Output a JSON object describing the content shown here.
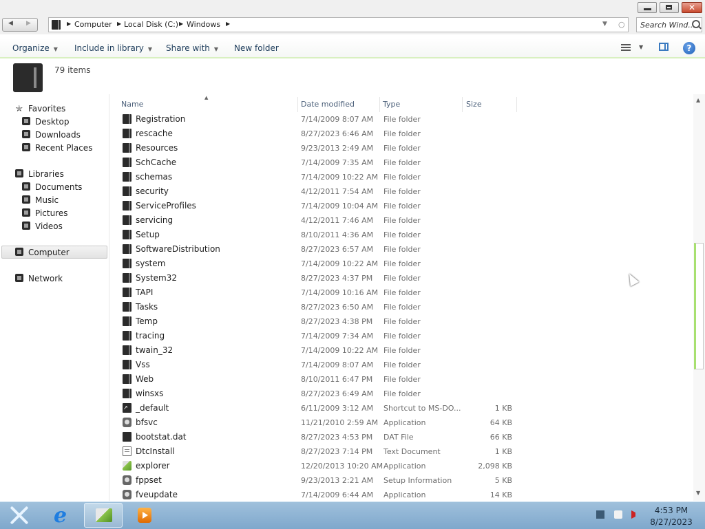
{
  "window": {
    "minimize_label": "",
    "maximize_label": "",
    "close_label": "✕"
  },
  "address": {
    "crumbs": [
      "Computer",
      "Local Disk (C:)",
      "Windows"
    ],
    "search_placeholder": "Search Wind..."
  },
  "toolbar": {
    "organize": "Organize",
    "include_in_library": "Include in library",
    "share_with": "Share with",
    "new_folder": "New folder"
  },
  "info": {
    "item_count": "79 items"
  },
  "sidebar": {
    "favorites": "Favorites",
    "desktop": "Desktop",
    "downloads": "Downloads",
    "recent_places": "Recent Places",
    "libraries": "Libraries",
    "documents": "Documents",
    "music": "Music",
    "pictures": "Pictures",
    "videos": "Videos",
    "computer": "Computer",
    "network": "Network"
  },
  "list": {
    "columns": {
      "name": "Name",
      "date": "Date modified",
      "type": "Type",
      "size": "Size"
    },
    "rows": [
      {
        "name": "Registration",
        "date": "7/14/2009 8:07 AM",
        "type": "File folder",
        "size": "",
        "icon": "folder-icon"
      },
      {
        "name": "rescache",
        "date": "8/27/2023 6:46 AM",
        "type": "File folder",
        "size": "",
        "icon": "folder-icon"
      },
      {
        "name": "Resources",
        "date": "9/23/2013 2:49 AM",
        "type": "File folder",
        "size": "",
        "icon": "folder-icon"
      },
      {
        "name": "SchCache",
        "date": "7/14/2009 7:35 AM",
        "type": "File folder",
        "size": "",
        "icon": "folder-icon"
      },
      {
        "name": "schemas",
        "date": "7/14/2009 10:22 AM",
        "type": "File folder",
        "size": "",
        "icon": "folder-icon"
      },
      {
        "name": "security",
        "date": "4/12/2011 7:54 AM",
        "type": "File folder",
        "size": "",
        "icon": "folder-icon"
      },
      {
        "name": "ServiceProfiles",
        "date": "7/14/2009 10:04 AM",
        "type": "File folder",
        "size": "",
        "icon": "folder-icon"
      },
      {
        "name": "servicing",
        "date": "4/12/2011 7:46 AM",
        "type": "File folder",
        "size": "",
        "icon": "folder-icon"
      },
      {
        "name": "Setup",
        "date": "8/10/2011 4:36 AM",
        "type": "File folder",
        "size": "",
        "icon": "folder-icon"
      },
      {
        "name": "SoftwareDistribution",
        "date": "8/27/2023 6:57 AM",
        "type": "File folder",
        "size": "",
        "icon": "folder-icon"
      },
      {
        "name": "system",
        "date": "7/14/2009 10:22 AM",
        "type": "File folder",
        "size": "",
        "icon": "folder-icon"
      },
      {
        "name": "System32",
        "date": "8/27/2023 4:37 PM",
        "type": "File folder",
        "size": "",
        "icon": "folder-icon"
      },
      {
        "name": "TAPI",
        "date": "7/14/2009 10:16 AM",
        "type": "File folder",
        "size": "",
        "icon": "folder-icon"
      },
      {
        "name": "Tasks",
        "date": "8/27/2023 6:50 AM",
        "type": "File folder",
        "size": "",
        "icon": "folder-icon"
      },
      {
        "name": "Temp",
        "date": "8/27/2023 4:38 PM",
        "type": "File folder",
        "size": "",
        "icon": "folder-icon"
      },
      {
        "name": "tracing",
        "date": "7/14/2009 7:34 AM",
        "type": "File folder",
        "size": "",
        "icon": "folder-icon"
      },
      {
        "name": "twain_32",
        "date": "7/14/2009 10:22 AM",
        "type": "File folder",
        "size": "",
        "icon": "folder-icon"
      },
      {
        "name": "Vss",
        "date": "7/14/2009 8:07 AM",
        "type": "File folder",
        "size": "",
        "icon": "folder-icon"
      },
      {
        "name": "Web",
        "date": "8/10/2011 6:47 PM",
        "type": "File folder",
        "size": "",
        "icon": "folder-icon"
      },
      {
        "name": "winsxs",
        "date": "8/27/2023 6:49 AM",
        "type": "File folder",
        "size": "",
        "icon": "folder-icon"
      },
      {
        "name": "_default",
        "date": "6/11/2009 3:12 AM",
        "type": "Shortcut to MS-DO...",
        "size": "1 KB",
        "icon": "shortcut-icon"
      },
      {
        "name": "bfsvc",
        "date": "11/21/2010 2:59 AM",
        "type": "Application",
        "size": "64 KB",
        "icon": "application-icon"
      },
      {
        "name": "bootstat.dat",
        "date": "8/27/2023 4:53 PM",
        "type": "DAT File",
        "size": "66 KB",
        "icon": "file-icon"
      },
      {
        "name": "DtcInstall",
        "date": "8/27/2023 7:14 PM",
        "type": "Text Document",
        "size": "1 KB",
        "icon": "text-document-icon"
      },
      {
        "name": "explorer",
        "date": "12/20/2013 10:20 AM",
        "type": "Application",
        "size": "2,098 KB",
        "icon": "explorer-icon"
      },
      {
        "name": "fppset",
        "date": "9/23/2013 2:21 AM",
        "type": "Setup Information",
        "size": "5 KB",
        "icon": "setup-info-icon"
      },
      {
        "name": "fveupdate",
        "date": "7/14/2009 6:44 AM",
        "type": "Application",
        "size": "14 KB",
        "icon": "application-icon"
      }
    ]
  },
  "taskbar": {
    "time": "4:53 PM",
    "date": "8/27/2023"
  }
}
